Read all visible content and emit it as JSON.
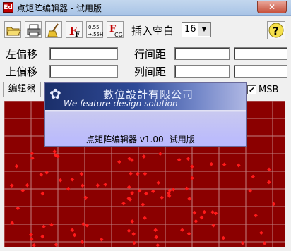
{
  "window": {
    "title": "点矩阵编辑器 - 试用版",
    "app_icon_text": "Ed"
  },
  "toolbar": {
    "insert_space_label": "插入空白",
    "insert_space_value": "16",
    "icon_texts": {
      "size_top": "0.55",
      "size_bottom": "→.55H",
      "font_f": "F",
      "font_sub": "CG"
    }
  },
  "fields": {
    "left_offset_label": "左偏移",
    "top_offset_label": "上偏移",
    "line_spacing_label": "行间距",
    "column_spacing_label": "列间距"
  },
  "editor": {
    "tab_label": "编辑器",
    "msb_label": "MSB",
    "msb_checked": "✔"
  },
  "splash": {
    "company": "數位設計有限公司",
    "slogan": "We feature design solution",
    "app_version_text": "点矩阵编辑器 v1.00   -试用版"
  },
  "colors": {
    "grid_bg": "#8b0000",
    "dot": "#ff1a1a",
    "grid_line": "#c08080"
  }
}
